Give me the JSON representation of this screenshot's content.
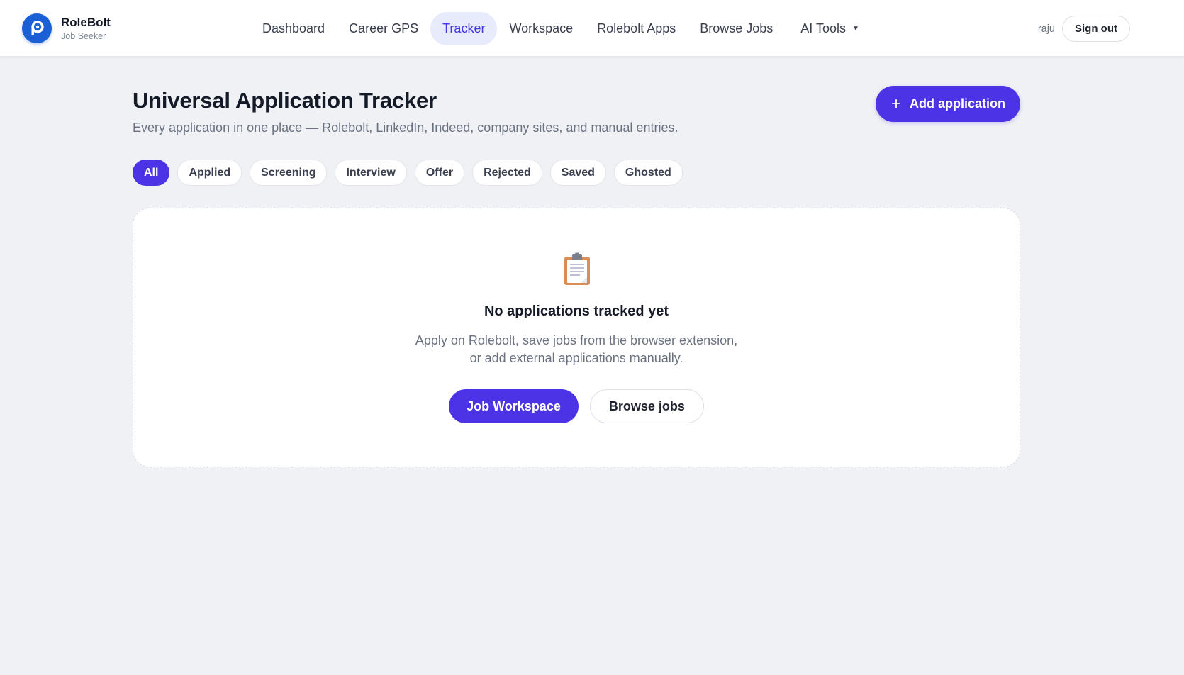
{
  "brand": {
    "name": "RoleBolt",
    "subtitle": "Job Seeker",
    "logo_icon": "rolebolt-logo-icon",
    "color": "#1a5fd6"
  },
  "nav": {
    "items": [
      {
        "label": "Dashboard",
        "active": false
      },
      {
        "label": "Career GPS",
        "active": false
      },
      {
        "label": "Tracker",
        "active": true
      },
      {
        "label": "Workspace",
        "active": false
      },
      {
        "label": "Rolebolt Apps",
        "active": false
      },
      {
        "label": "Browse Jobs",
        "active": false
      },
      {
        "label": "AI Tools",
        "active": false,
        "dropdown": true
      }
    ]
  },
  "user": {
    "name": "raju",
    "signout_label": "Sign out"
  },
  "page": {
    "title": "Universal Application Tracker",
    "subtitle": "Every application in one place — Rolebolt, LinkedIn, Indeed, company sites, and manual entries.",
    "add_button": {
      "label": "Add application",
      "icon": "plus-icon"
    }
  },
  "filters": [
    {
      "label": "All",
      "active": true
    },
    {
      "label": "Applied",
      "active": false
    },
    {
      "label": "Screening",
      "active": false
    },
    {
      "label": "Interview",
      "active": false
    },
    {
      "label": "Offer",
      "active": false
    },
    {
      "label": "Rejected",
      "active": false
    },
    {
      "label": "Saved",
      "active": false
    },
    {
      "label": "Ghosted",
      "active": false
    }
  ],
  "empty_state": {
    "icon": "clipboard-icon",
    "title": "No applications tracked yet",
    "description_line1": "Apply on Rolebolt, save jobs from the browser extension,",
    "description_line2": "or add external applications manually.",
    "primary_action": "Job Workspace",
    "secondary_action": "Browse jobs"
  },
  "colors": {
    "accent": "#4c33e6",
    "active_nav_bg": "#e8ebfb",
    "active_nav_text": "#4338e0",
    "page_bg": "#f0f1f5"
  }
}
